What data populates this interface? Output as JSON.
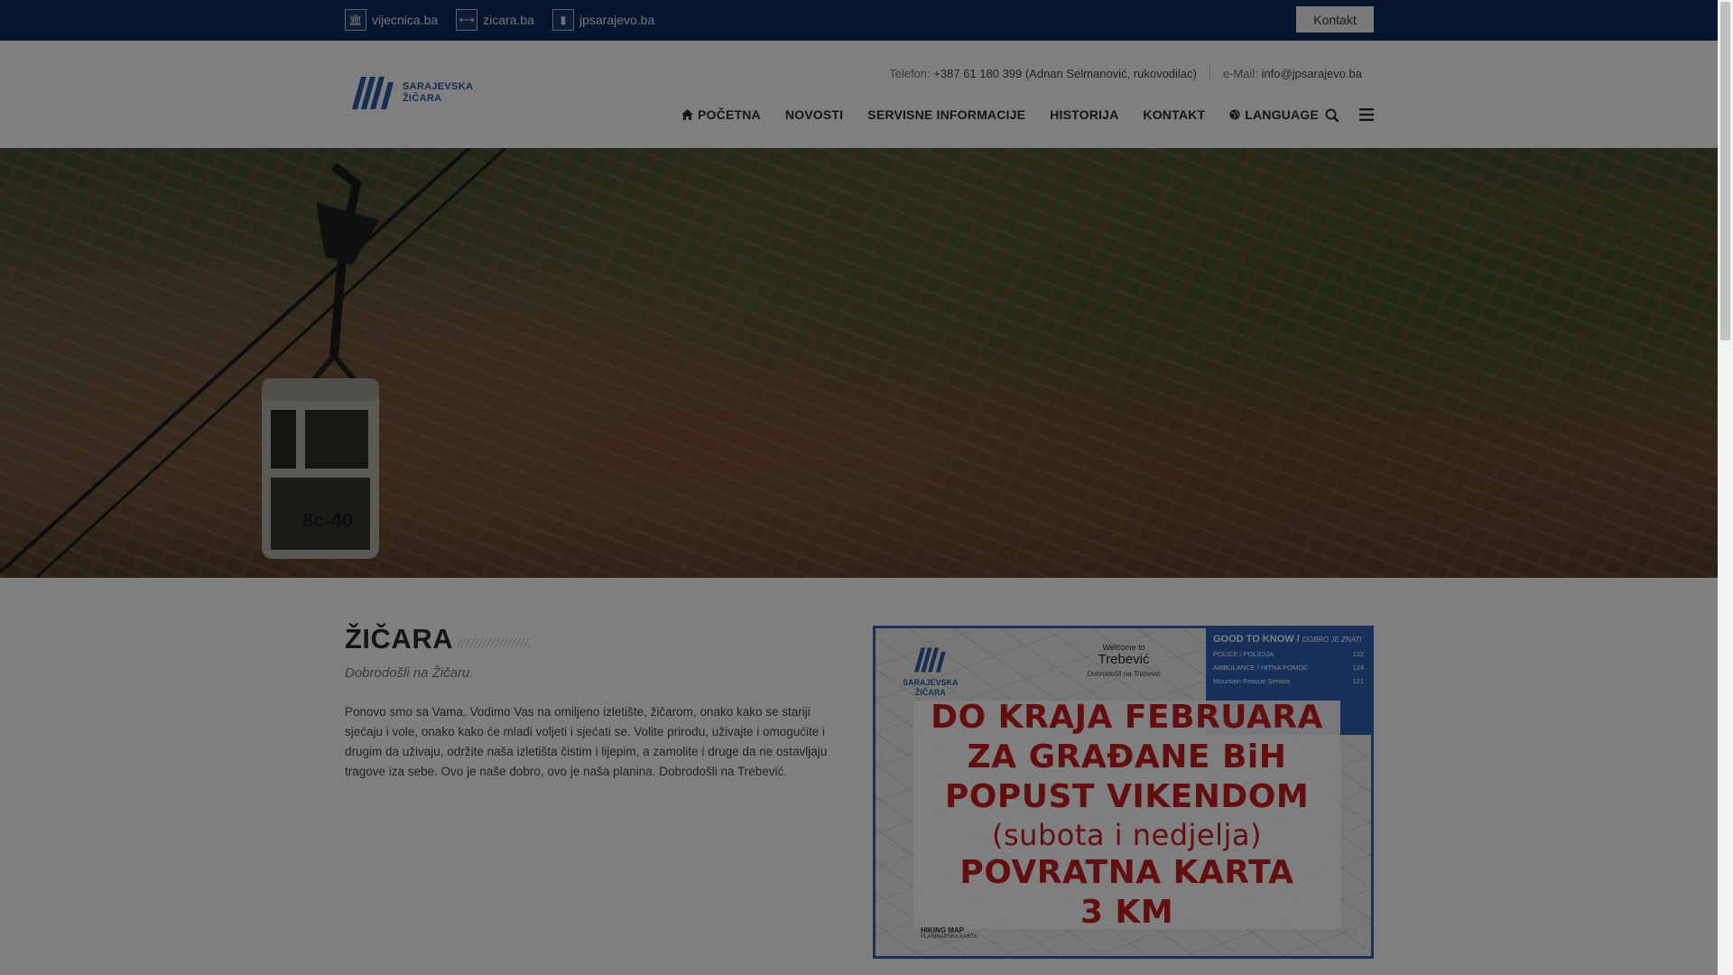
{
  "topbar": {
    "links": [
      {
        "label": "vijecnica.ba",
        "icon": "building-icon"
      },
      {
        "label": "zicara.ba",
        "icon": "cable-icon"
      },
      {
        "label": "jpsarajevo.ba",
        "icon": "page-icon"
      }
    ],
    "kontakt_label": "Kontakt"
  },
  "header": {
    "logo_line1": "SARAJEVSKA",
    "logo_line2": "ŽIČARA",
    "phone_label": "Telefon:",
    "phone_value": "+387 61 180 399 (Adnan Selmanović, rukovodilac)",
    "email_label": "e-Mail:",
    "email_value": "info@jpsarajevo.ba"
  },
  "nav": {
    "items": [
      {
        "label": "POČETNA",
        "icon": "home-icon"
      },
      {
        "label": "NOVOSTI"
      },
      {
        "label": "SERVISNE INFORMACIJE"
      },
      {
        "label": "HISTORIJA"
      },
      {
        "label": "KONTAKT"
      },
      {
        "label": "LANGUAGE",
        "icon": "globe-icon"
      }
    ]
  },
  "hero": {
    "cabin_number": "8c-40"
  },
  "main": {
    "title": "ŽIČARA",
    "subtitle": "Dobrodošli na Žičaru.",
    "body": "Ponovo smo sa Vama. Vodimo Vas na omiljeno izletište, žičarom, onako kako se stariji sjećaju i vole, onako kako će mladi voljeti i sjećati se. Volite prirodu, uživajte i omogućite i drugim da uživaju, održite naša izletišta čistim i lijepim, a zamolite i druge da ne ostavljaju tragove iza sebe. Ovo je naše dobro, ovo je naša planina. Dobrodošli na Trebević."
  },
  "promo": {
    "logo_line1": "SARAJEVSKA",
    "logo_line2": "ŽIČARA",
    "welcome_to": "Welcome to",
    "place": "Trebević",
    "welcome_local": "Dobrodošli na Trebević",
    "good_to_know": "GOOD TO KNOW /",
    "good_to_know_local": "DOBRO JE ZNATI",
    "services": [
      {
        "name": "POLICE /",
        "local": "POLICIJA",
        "number": "122"
      },
      {
        "name": "AMBULANCE /",
        "local": "HITNA POMOĆ",
        "number": "124"
      },
      {
        "name": "Mountain Rescue Service",
        "local": "",
        "number": "121"
      }
    ],
    "lines": [
      "DO KRAJA FEBRUARA",
      "ZA GRAĐANE BiH",
      "POPUST VIKENDOM",
      "(subota i nedjelja)",
      "POVRATNA KARTA",
      "3 KM"
    ],
    "hiking_map": "HIKING MAP",
    "hiking_map_local": "PLANINARSKA KARTA"
  },
  "colors": {
    "topbar": "#0b2a5c",
    "brand_blue": "#2a5aa8",
    "promo_red": "#c81e1e",
    "promo_border": "#2f63b5"
  }
}
